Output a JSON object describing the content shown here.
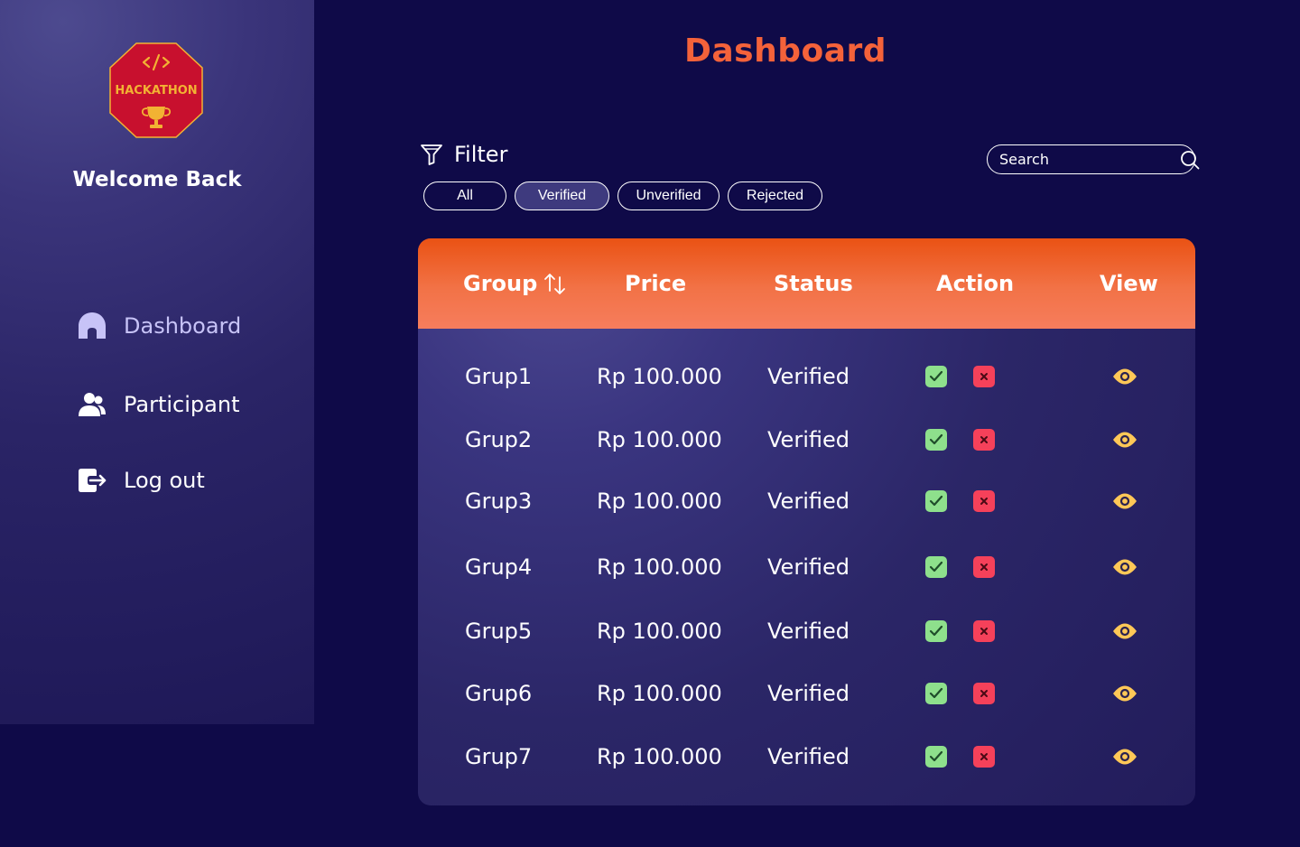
{
  "brand": {
    "logo_text": "HACKATHON",
    "logo_code_symbol": "</>"
  },
  "sidebar": {
    "welcome": "Welcome Back",
    "items": [
      {
        "label": "Dashboard",
        "icon": "home-icon",
        "active": true
      },
      {
        "label": "Participant",
        "icon": "users-icon",
        "active": false
      },
      {
        "label": "Log out",
        "icon": "logout-icon",
        "active": false
      }
    ]
  },
  "header": {
    "title": "Dashboard"
  },
  "filter": {
    "label": "Filter",
    "chips": [
      "All",
      "Verified",
      "Unverified",
      "Rejected"
    ],
    "active_chip": "Verified"
  },
  "search": {
    "placeholder": "Search",
    "value": ""
  },
  "table": {
    "columns": [
      "Group",
      "Price",
      "Status",
      "Action",
      "View"
    ],
    "rows": [
      {
        "group": "Grup1",
        "price": "Rp 100.000",
        "status": "Verified"
      },
      {
        "group": "Grup2",
        "price": "Rp 100.000",
        "status": "Verified"
      },
      {
        "group": "Grup3",
        "price": "Rp 100.000",
        "status": "Verified"
      },
      {
        "group": "Grup4",
        "price": "Rp 100.000",
        "status": "Verified"
      },
      {
        "group": "Grup5",
        "price": "Rp 100.000",
        "status": "Verified"
      },
      {
        "group": "Grup6",
        "price": "Rp 100.000",
        "status": "Verified"
      },
      {
        "group": "Grup7",
        "price": "Rp 100.000",
        "status": "Verified"
      }
    ]
  },
  "colors": {
    "background": "#0f0a48",
    "title": "#f4623a",
    "header_gradient_top": "#ea5214",
    "header_gradient_bottom": "#f67d5d",
    "approve": "#8ee08c",
    "reject": "#f5415a",
    "view": "#ffc857",
    "logo_fill": "#c8102e",
    "logo_gold": "#f2b233"
  }
}
